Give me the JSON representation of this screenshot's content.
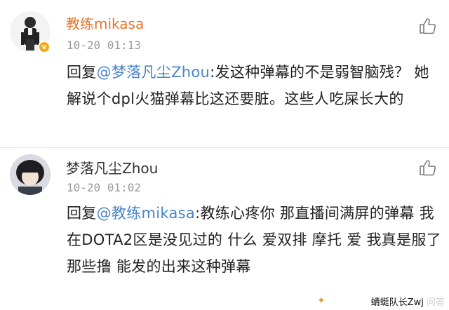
{
  "comments": [
    {
      "username": "教练mikasa",
      "timestamp": "10-20 01:13",
      "reply_prefix": "回复",
      "mention": "@梦落凡尘Zhou",
      "text": ":发这种弹幕的不是弱智脑残？ 她解说个dpl火猫弹幕比这还要脏。这些人吃屎长大的",
      "verified_badge": "v"
    },
    {
      "username": "梦落凡尘Zhou",
      "timestamp": "10-20 01:02",
      "reply_prefix": "回复",
      "mention": "@教练mikasa",
      "text": ":教练心疼你  那直播间满屏的弹幕 我在DOTA2区是没见过的  什么     爱双排 摩托     爱  我真是服了那些撸  能发的出来这种弹幕"
    }
  ],
  "watermark": {
    "text": "蜻蜓队长Zwj",
    "faded": "问答"
  },
  "colors": {
    "username_highlight": "#e8742a",
    "mention": "#4a84c9",
    "timestamp": "#9a9a9a"
  },
  "icons": {
    "like": "thumbs-up-icon",
    "verified": "verified-badge-icon"
  }
}
